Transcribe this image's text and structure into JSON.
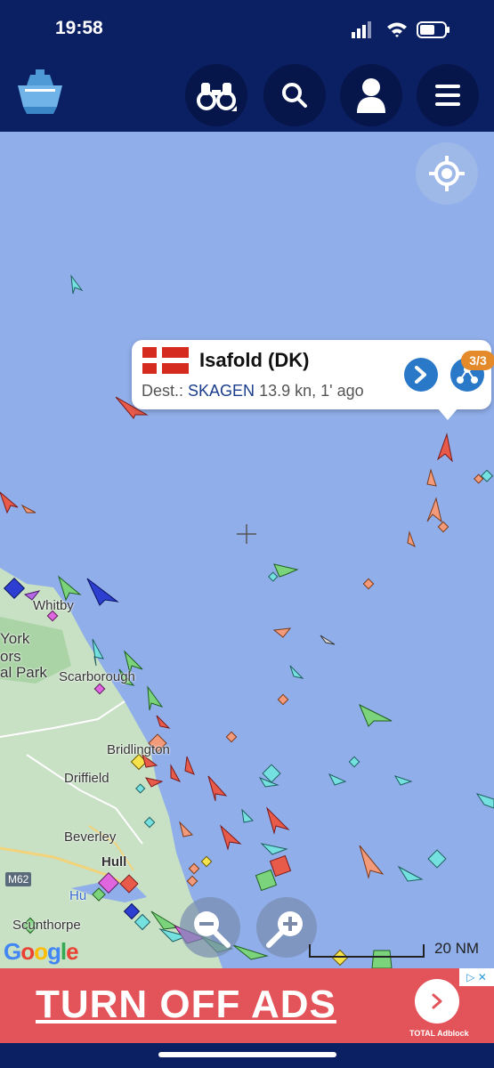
{
  "status_bar": {
    "time": "19:58"
  },
  "nav": {
    "icons": [
      "logo-ship-icon",
      "binoculars-icon",
      "search-icon",
      "user-icon",
      "menu-icon"
    ]
  },
  "popup": {
    "vessel_name": "Isafold (DK)",
    "dest_label": "Dest.:",
    "dest_value": "SKAGEN",
    "speed_age": "13.9 kn, 1' ago",
    "badge": "3/3",
    "flag_colors": {
      "red": "#d52b1e",
      "white": "#ffffff"
    }
  },
  "map": {
    "places": [
      "Whitby",
      "York",
      "ors",
      "al Park",
      "Scarborough",
      "Bridlington",
      "Driffield",
      "Beverley",
      "Hull",
      "Hu",
      "M62",
      "Scunthorpe"
    ],
    "scale_label": "20 NM",
    "attribution": "Google",
    "colors": {
      "sea": "#90aeea",
      "land": "#c8e0c4",
      "cargo": "#7bd47b",
      "tanker": "#e85a4a",
      "passenger": "#2c3fd1",
      "tug": "#74e0e0"
    }
  },
  "ad": {
    "text": "TURN OFF ADS",
    "brand": "TOTAL Adblock",
    "adchoices": "▷ ✕"
  }
}
